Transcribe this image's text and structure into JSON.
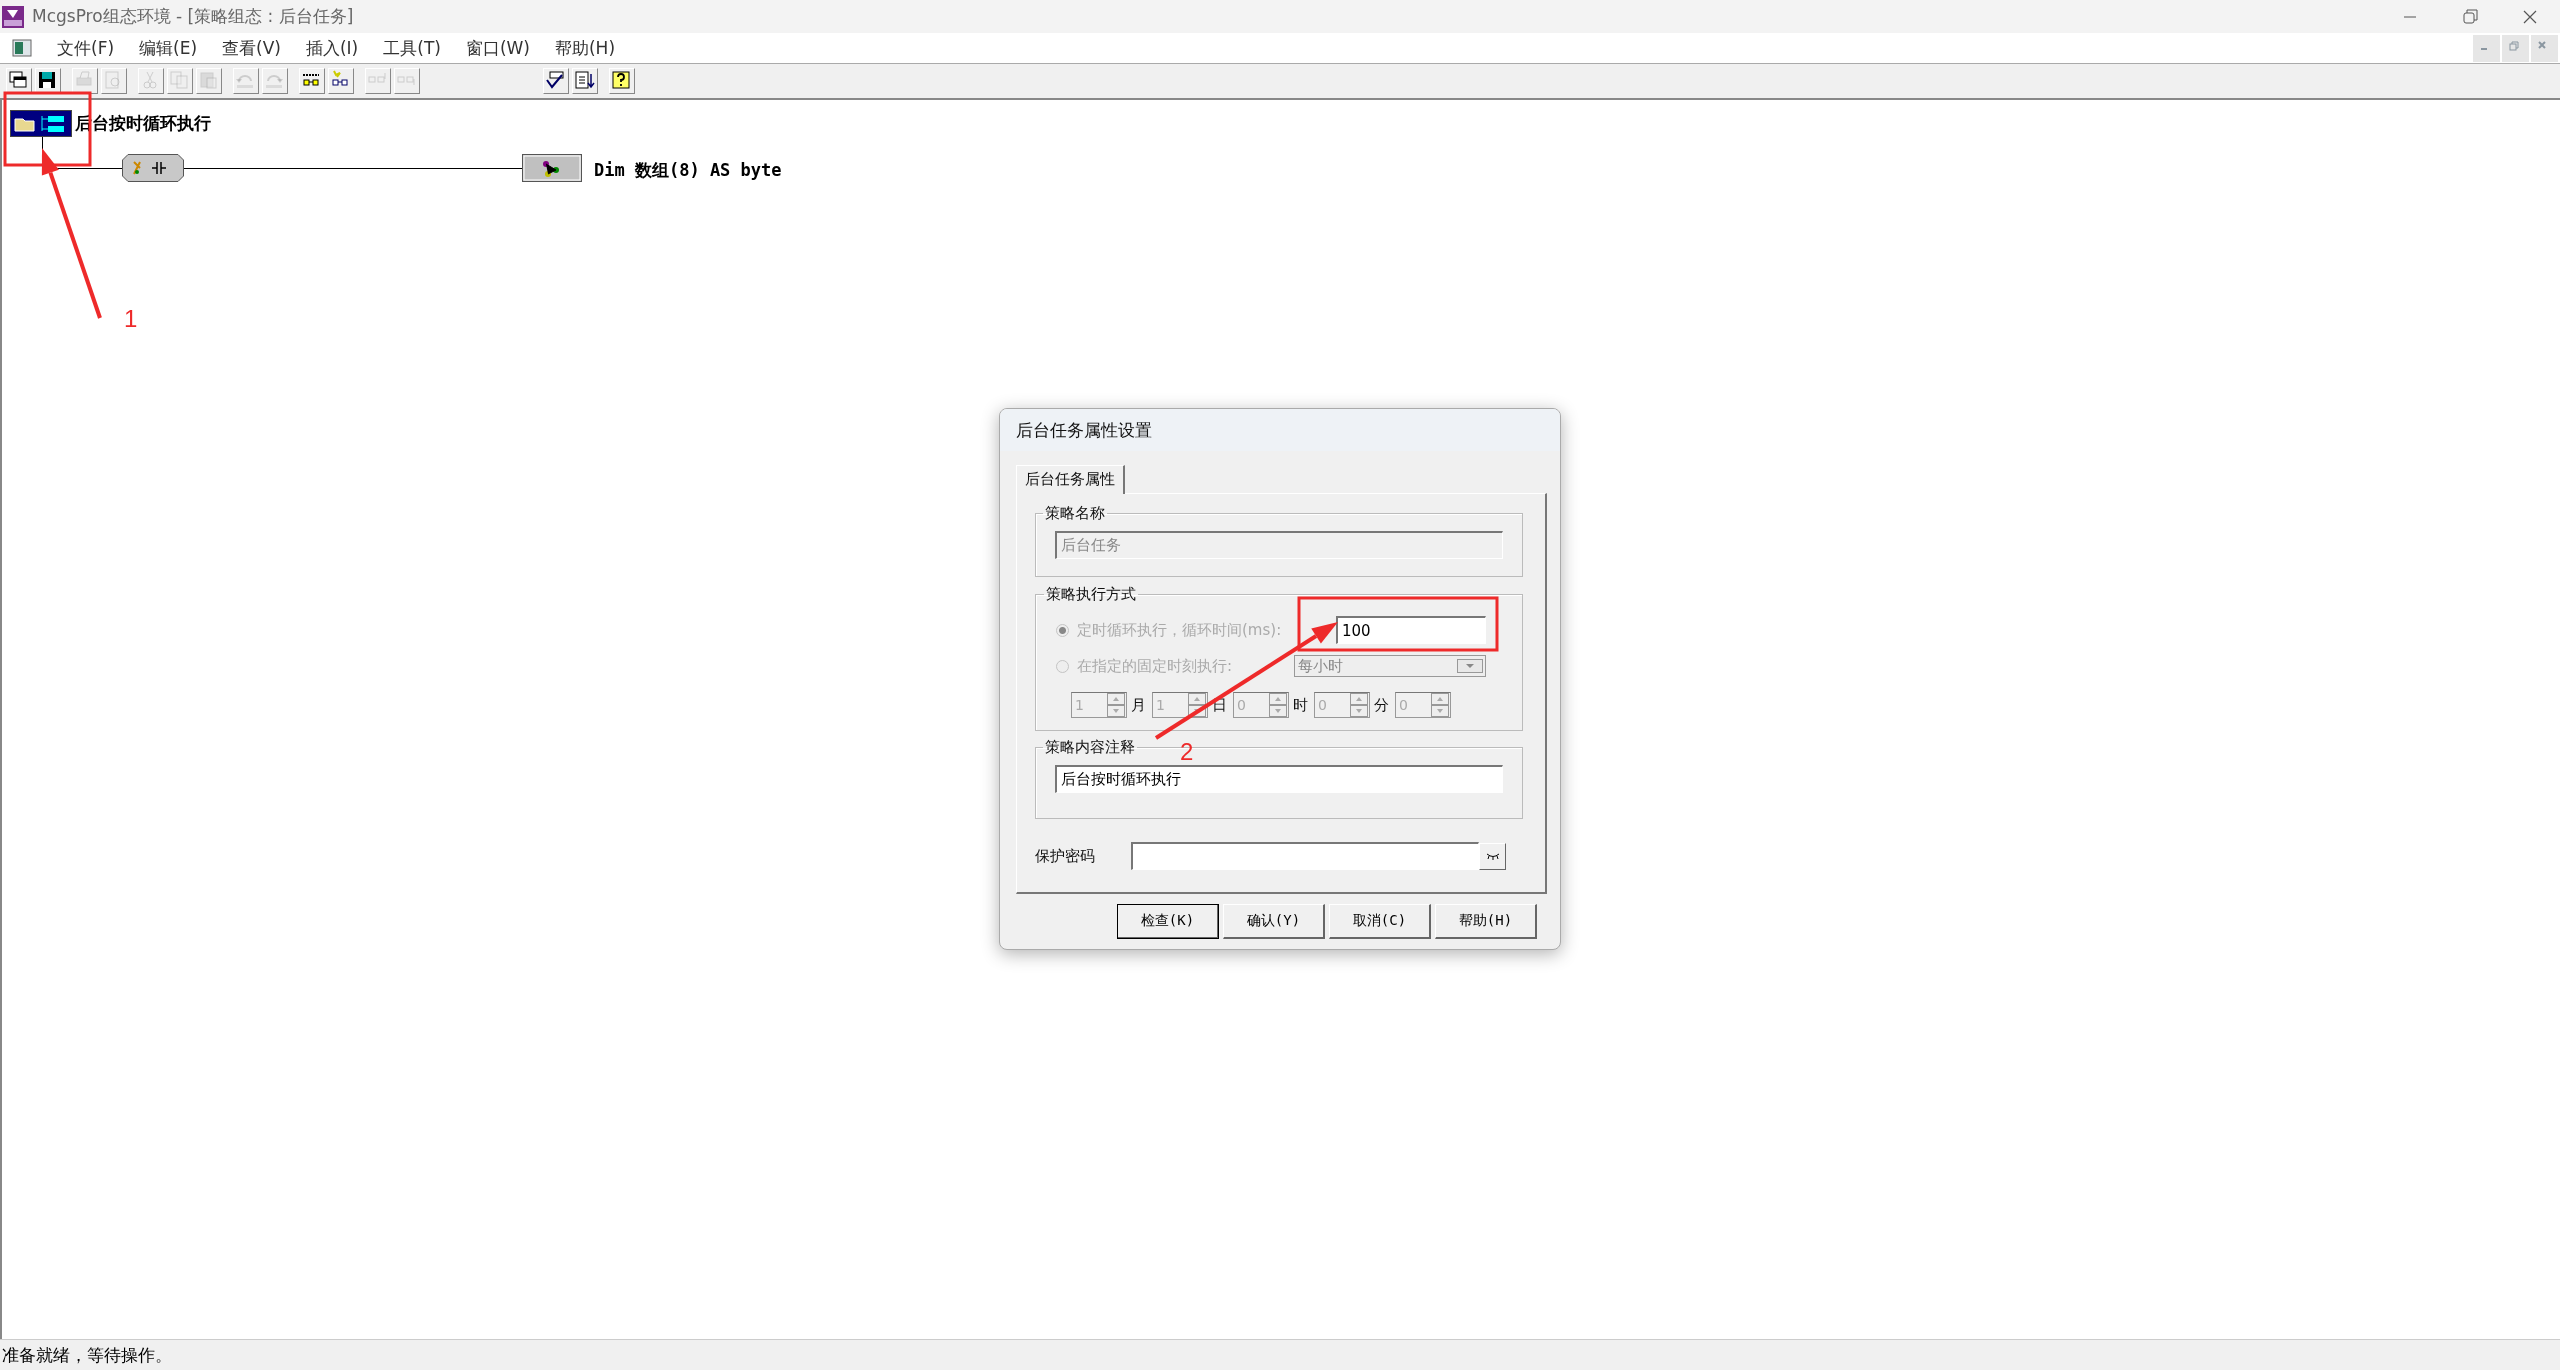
{
  "window": {
    "title": "McgsPro组态环境 - [策略组态 : 后台任务]"
  },
  "menu": [
    {
      "label": "文件(F)"
    },
    {
      "label": "编辑(E)"
    },
    {
      "label": "查看(V)"
    },
    {
      "label": "插入(I)"
    },
    {
      "label": "工具(T)"
    },
    {
      "label": "窗口(W)"
    },
    {
      "label": "帮助(H)"
    }
  ],
  "toolbar": [
    {
      "kind": "windows",
      "disabled": false
    },
    {
      "kind": "save",
      "disabled": false
    },
    {
      "kind": "separator"
    },
    {
      "kind": "print",
      "disabled": true
    },
    {
      "kind": "preview",
      "disabled": true
    },
    {
      "kind": "separator"
    },
    {
      "kind": "cut",
      "disabled": true
    },
    {
      "kind": "copy",
      "disabled": true
    },
    {
      "kind": "paste",
      "disabled": true
    },
    {
      "kind": "separator"
    },
    {
      "kind": "undo",
      "disabled": true
    },
    {
      "kind": "redo",
      "disabled": true
    },
    {
      "kind": "separator"
    },
    {
      "kind": "row",
      "disabled": false
    },
    {
      "kind": "newrow",
      "disabled": false
    },
    {
      "kind": "separator"
    },
    {
      "kind": "rowup",
      "disabled": true
    },
    {
      "kind": "rowdown",
      "disabled": true
    },
    {
      "kind": "gap"
    },
    {
      "kind": "check",
      "disabled": false
    },
    {
      "kind": "sort",
      "disabled": false
    },
    {
      "kind": "separator"
    },
    {
      "kind": "help",
      "disabled": false
    }
  ],
  "strategy": {
    "title": "后台按时循环执行",
    "rows": [
      {
        "action": "Dim 数组(8) AS byte"
      }
    ]
  },
  "dialog": {
    "title": "后台任务属性设置",
    "tabs": [
      {
        "label": "后台任务属性",
        "selected": true
      }
    ],
    "name_group": {
      "label": "策略名称",
      "value": "后台任务",
      "disabled": true
    },
    "mode_group": {
      "label": "策略执行方式",
      "options": [
        {
          "label": "定时循环执行，循环时间(ms):",
          "selected": true,
          "disabled": true
        },
        {
          "label": "在指定的固定时刻执行:",
          "selected": false,
          "disabled": true
        }
      ],
      "interval": "100",
      "schedule": "每小时",
      "spinners": [
        {
          "value": "1",
          "unit": "月"
        },
        {
          "value": "1",
          "unit": "日"
        },
        {
          "value": "0",
          "unit": "时"
        },
        {
          "value": "0",
          "unit": "分"
        },
        {
          "value": "0"
        }
      ]
    },
    "comment_group": {
      "label": "策略内容注释",
      "value": "后台按时循环执行"
    },
    "password": {
      "label": "保护密码"
    },
    "buttons": [
      {
        "label": "检查(K)",
        "default": true
      },
      {
        "label": "确认(Y)",
        "default": false
      },
      {
        "label": "取消(C)",
        "default": false
      },
      {
        "label": "帮助(H)",
        "default": false
      }
    ]
  },
  "status_bar": {
    "text": "准备就绪，等待操作。"
  },
  "annotations": [
    {
      "label": "1"
    },
    {
      "label": "2"
    }
  ]
}
